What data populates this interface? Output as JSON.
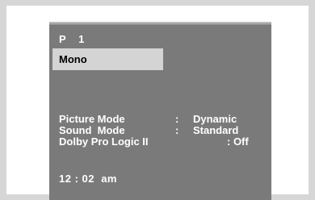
{
  "channel": {
    "prefix": "P",
    "number": "1"
  },
  "audio": {
    "mode": "Mono"
  },
  "info": [
    {
      "label": "Picture Mode",
      "separator": ":",
      "value": "Dynamic"
    },
    {
      "label": "Sound  Mode",
      "separator": ":",
      "value": "Standard"
    },
    {
      "label": "Dolby Pro Logic II",
      "separator": "",
      "value": ": Off"
    }
  ],
  "clock": "12 : 02  am",
  "colors": {
    "background": "#d6d6d6",
    "frame": "#ffffff",
    "screen": "#7a7a7a",
    "highlight": "#d4d4d4",
    "text": "#ffffff"
  }
}
